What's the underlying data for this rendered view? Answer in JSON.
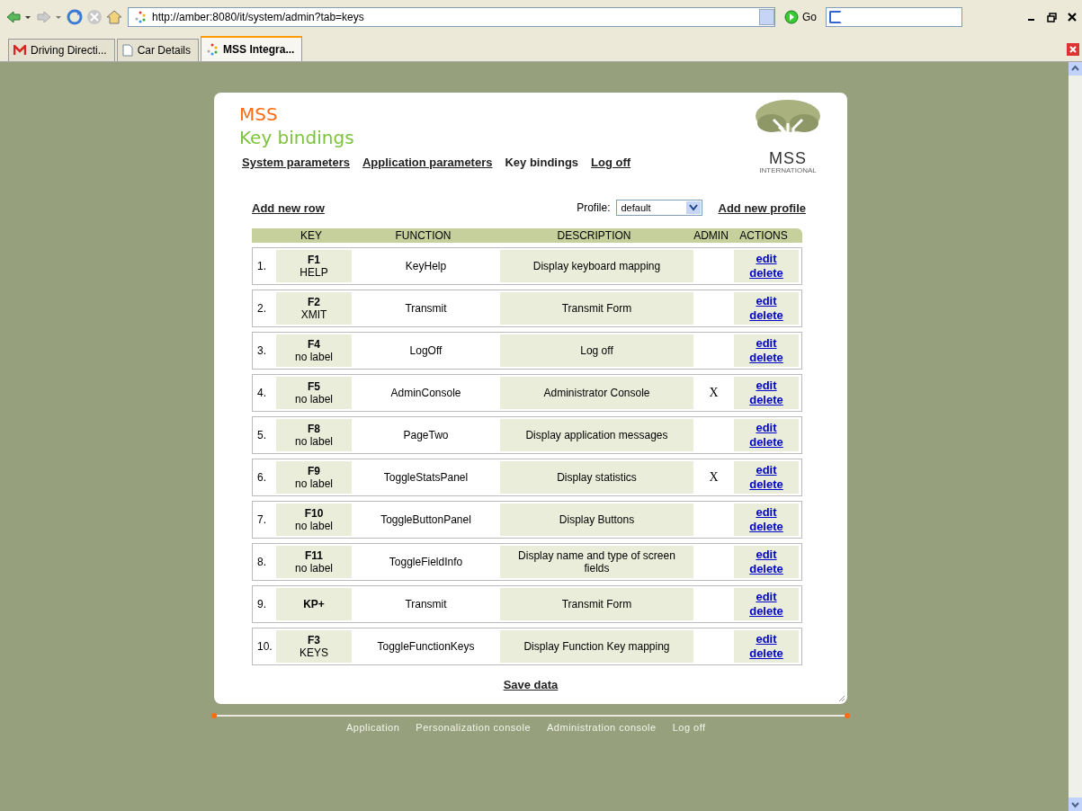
{
  "browser": {
    "address": "http://amber:8080/it/system/admin?tab=keys",
    "go_label": "Go",
    "tabs": [
      {
        "label": "Driving Directi...",
        "selected": false
      },
      {
        "label": "Car Details",
        "selected": false
      },
      {
        "label": "MSS Integra...",
        "selected": true
      }
    ]
  },
  "header": {
    "brand": "MSS",
    "title": "Key bindings",
    "logo_text": "MSS",
    "logo_subtext": "INTERNATIONAL",
    "nav": [
      {
        "label": "System parameters",
        "selected": false
      },
      {
        "label": "Application parameters",
        "selected": false
      },
      {
        "label": "Key bindings",
        "selected": true
      },
      {
        "label": "Log off",
        "selected": false
      }
    ]
  },
  "toolbar": {
    "add_row": "Add new row",
    "profile_label": "Profile:",
    "profile_value": "default",
    "add_profile": "Add new profile"
  },
  "table": {
    "columns": [
      "KEY",
      "FUNCTION",
      "DESCRIPTION",
      "ADMIN",
      "ACTIONS"
    ],
    "rows": [
      {
        "number": "1.",
        "key": "F1",
        "key_label": "HELP",
        "function": "KeyHelp",
        "description": "Display keyboard mapping",
        "edit": "edit",
        "delete": "delete"
      },
      {
        "number": "2.",
        "key": "F2",
        "key_label": "XMIT",
        "function": "Transmit",
        "description": "Transmit Form",
        "edit": "edit",
        "delete": "delete"
      },
      {
        "number": "3.",
        "key": "F4",
        "key_label": "no label",
        "function": "LogOff",
        "description": "Log off",
        "edit": "edit",
        "delete": "delete"
      },
      {
        "number": "4.",
        "key": "F5",
        "key_label": "no label",
        "function": "AdminConsole",
        "description": "Administrator Console",
        "admin_mark": "X",
        "edit": "edit",
        "delete": "delete"
      },
      {
        "number": "5.",
        "key": "F8",
        "key_label": "no label",
        "function": "PageTwo",
        "description": "Display application messages",
        "edit": "edit",
        "delete": "delete"
      },
      {
        "number": "6.",
        "key": "F9",
        "key_label": "no label",
        "function": "ToggleStatsPanel",
        "description": "Display statistics",
        "admin_mark": "X",
        "edit": "edit",
        "delete": "delete"
      },
      {
        "number": "7.",
        "key": "F10",
        "key_label": "no label",
        "function": "ToggleButtonPanel",
        "description": "Display Buttons",
        "edit": "edit",
        "delete": "delete"
      },
      {
        "number": "8.",
        "key": "F11",
        "key_label": "no label",
        "function": "ToggleFieldInfo",
        "description": "Display name and type of screen fields",
        "edit": "edit",
        "delete": "delete"
      },
      {
        "number": "9.",
        "key": "KP+",
        "function": "Transmit",
        "description": "Transmit Form",
        "edit": "edit",
        "delete": "delete"
      },
      {
        "number": "10.",
        "key": "F3",
        "key_label": "KEYS",
        "function": "ToggleFunctionKeys",
        "description": "Display Function Key mapping",
        "edit": "edit",
        "delete": "delete"
      }
    ]
  },
  "save": "Save data",
  "footer": [
    "Application",
    "Personalization console",
    "Administration console",
    "Log off"
  ]
}
